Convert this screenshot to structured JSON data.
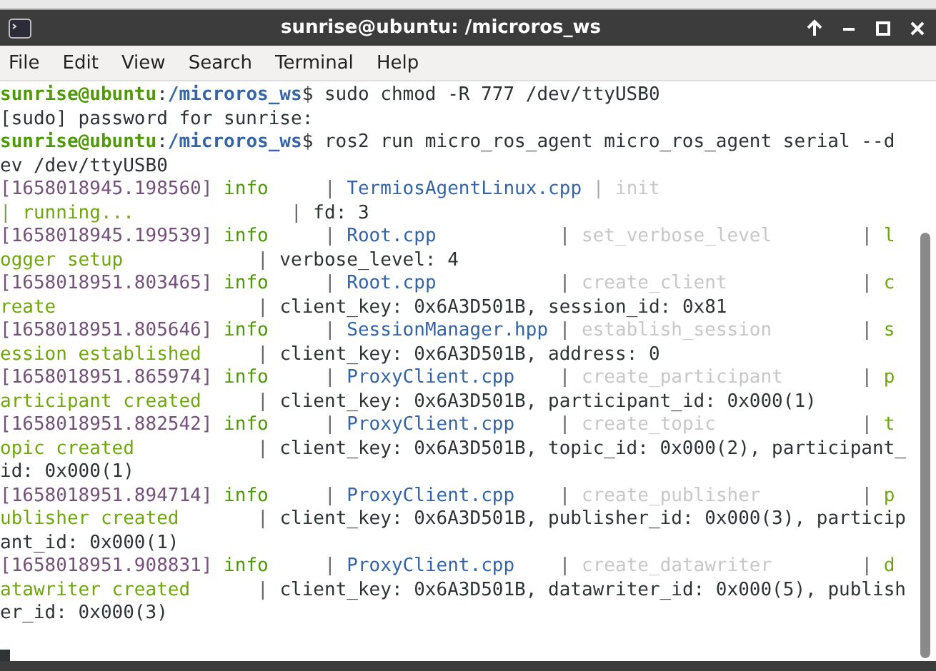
{
  "window": {
    "title": "sunrise@ubuntu: /microros_ws"
  },
  "menu": [
    "File",
    "Edit",
    "View",
    "Search",
    "Terminal",
    "Help"
  ],
  "terminal": {
    "cursor": true,
    "lines": [
      [
        {
          "kind": "user",
          "text": "sunrise@ubuntu"
        },
        {
          "kind": "text",
          "text": ":"
        },
        {
          "kind": "path",
          "text": "/microros_ws"
        },
        {
          "kind": "text",
          "text": "$ sudo chmod -R 777 /dev/ttyUSB0"
        }
      ],
      [
        {
          "kind": "text",
          "text": "[sudo] password for sunrise:"
        }
      ],
      [
        {
          "kind": "user",
          "text": "sunrise@ubuntu"
        },
        {
          "kind": "text",
          "text": ":"
        },
        {
          "kind": "path",
          "text": "/microros_ws"
        },
        {
          "kind": "text",
          "text": "$ ros2 run micro_ros_agent micro_ros_agent serial --d"
        }
      ],
      [
        {
          "kind": "text",
          "text": "ev /dev/ttyUSB0"
        }
      ],
      [
        {
          "kind": "ts",
          "text": "[1658018945.198560] "
        },
        {
          "kind": "level",
          "text": "info"
        },
        {
          "kind": "sep",
          "text": "     | "
        },
        {
          "kind": "file",
          "text": "TermiosAgentLinux.cpp"
        },
        {
          "kind": "sep_light",
          "text": " | "
        },
        {
          "kind": "func",
          "text": "init"
        }
      ],
      [
        {
          "kind": "sep_msg",
          "text": "| "
        },
        {
          "kind": "msg",
          "text": "running..."
        },
        {
          "kind": "sep",
          "text": "              | "
        },
        {
          "kind": "text",
          "text": "fd: 3"
        }
      ],
      [
        {
          "kind": "ts",
          "text": "[1658018945.199539] "
        },
        {
          "kind": "level",
          "text": "info"
        },
        {
          "kind": "sep",
          "text": "     | "
        },
        {
          "kind": "file",
          "text": "Root.cpp"
        },
        {
          "kind": "sep",
          "text": "           | "
        },
        {
          "kind": "func",
          "text": "set_verbose_level"
        },
        {
          "kind": "sep",
          "text": "        | "
        },
        {
          "kind": "msg",
          "text": "l"
        }
      ],
      [
        {
          "kind": "msg",
          "text": "ogger setup"
        },
        {
          "kind": "sep",
          "text": "            | "
        },
        {
          "kind": "text",
          "text": "verbose_level: 4"
        }
      ],
      [
        {
          "kind": "ts",
          "text": "[1658018951.803465] "
        },
        {
          "kind": "level",
          "text": "info"
        },
        {
          "kind": "sep",
          "text": "     | "
        },
        {
          "kind": "file",
          "text": "Root.cpp"
        },
        {
          "kind": "sep",
          "text": "           | "
        },
        {
          "kind": "func",
          "text": "create_client"
        },
        {
          "kind": "sep",
          "text": "            | "
        },
        {
          "kind": "msg",
          "text": "c"
        }
      ],
      [
        {
          "kind": "msg",
          "text": "reate"
        },
        {
          "kind": "sep",
          "text": "                  | "
        },
        {
          "kind": "text",
          "text": "client_key: 0x6A3D501B, session_id: 0x81"
        }
      ],
      [
        {
          "kind": "ts",
          "text": "[1658018951.805646] "
        },
        {
          "kind": "level",
          "text": "info"
        },
        {
          "kind": "sep",
          "text": "     | "
        },
        {
          "kind": "file",
          "text": "SessionManager.hpp"
        },
        {
          "kind": "sep",
          "text": " | "
        },
        {
          "kind": "func",
          "text": "establish_session"
        },
        {
          "kind": "sep",
          "text": "        | "
        },
        {
          "kind": "msg",
          "text": "s"
        }
      ],
      [
        {
          "kind": "msg",
          "text": "ession established"
        },
        {
          "kind": "sep",
          "text": "     | "
        },
        {
          "kind": "text",
          "text": "client_key: 0x6A3D501B, address: 0"
        }
      ],
      [
        {
          "kind": "ts",
          "text": "[1658018951.865974] "
        },
        {
          "kind": "level",
          "text": "info"
        },
        {
          "kind": "sep",
          "text": "     | "
        },
        {
          "kind": "file",
          "text": "ProxyClient.cpp"
        },
        {
          "kind": "sep",
          "text": "    | "
        },
        {
          "kind": "func",
          "text": "create_participant"
        },
        {
          "kind": "sep",
          "text": "       | "
        },
        {
          "kind": "msg",
          "text": "p"
        }
      ],
      [
        {
          "kind": "msg",
          "text": "articipant created"
        },
        {
          "kind": "sep",
          "text": "     | "
        },
        {
          "kind": "text",
          "text": "client_key: 0x6A3D501B, participant_id: 0x000(1)"
        }
      ],
      [
        {
          "kind": "ts",
          "text": "[1658018951.882542] "
        },
        {
          "kind": "level",
          "text": "info"
        },
        {
          "kind": "sep",
          "text": "     | "
        },
        {
          "kind": "file",
          "text": "ProxyClient.cpp"
        },
        {
          "kind": "sep",
          "text": "    | "
        },
        {
          "kind": "func",
          "text": "create_topic"
        },
        {
          "kind": "sep",
          "text": "             | "
        },
        {
          "kind": "msg",
          "text": "t"
        }
      ],
      [
        {
          "kind": "msg",
          "text": "opic created"
        },
        {
          "kind": "sep",
          "text": "           | "
        },
        {
          "kind": "text",
          "text": "client_key: 0x6A3D501B, topic_id: 0x000(2), participant_"
        }
      ],
      [
        {
          "kind": "text",
          "text": "id: 0x000(1)"
        }
      ],
      [
        {
          "kind": "ts",
          "text": "[1658018951.894714] "
        },
        {
          "kind": "level",
          "text": "info"
        },
        {
          "kind": "sep",
          "text": "     | "
        },
        {
          "kind": "file",
          "text": "ProxyClient.cpp"
        },
        {
          "kind": "sep",
          "text": "    | "
        },
        {
          "kind": "func",
          "text": "create_publisher"
        },
        {
          "kind": "sep",
          "text": "         | "
        },
        {
          "kind": "msg",
          "text": "p"
        }
      ],
      [
        {
          "kind": "msg",
          "text": "ublisher created"
        },
        {
          "kind": "sep",
          "text": "       | "
        },
        {
          "kind": "text",
          "text": "client_key: 0x6A3D501B, publisher_id: 0x000(3), particip"
        }
      ],
      [
        {
          "kind": "text",
          "text": "ant_id: 0x000(1)"
        }
      ],
      [
        {
          "kind": "ts",
          "text": "[1658018951.908831] "
        },
        {
          "kind": "level",
          "text": "info"
        },
        {
          "kind": "sep",
          "text": "     | "
        },
        {
          "kind": "file",
          "text": "ProxyClient.cpp"
        },
        {
          "kind": "sep",
          "text": "    | "
        },
        {
          "kind": "func",
          "text": "create_datawriter"
        },
        {
          "kind": "sep",
          "text": "        | "
        },
        {
          "kind": "msg",
          "text": "d"
        }
      ],
      [
        {
          "kind": "msg",
          "text": "atawriter created"
        },
        {
          "kind": "sep",
          "text": "      | "
        },
        {
          "kind": "text",
          "text": "client_key: 0x6A3D501B, datawriter_id: 0x000(5), publish"
        }
      ],
      [
        {
          "kind": "text",
          "text": "er_id: 0x000(3)"
        }
      ]
    ]
  }
}
